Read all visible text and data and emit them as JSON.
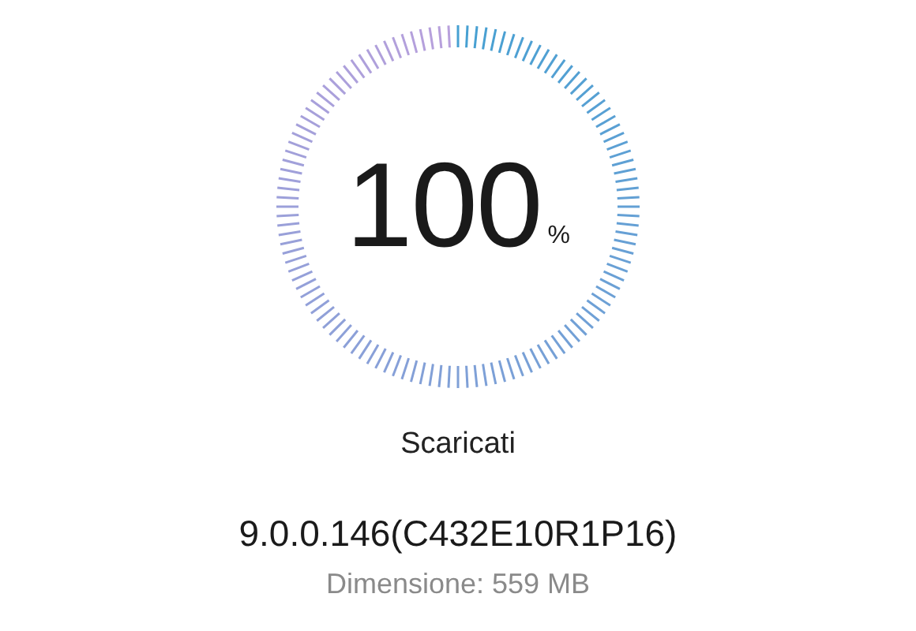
{
  "progress": {
    "value": "100",
    "unit": "%"
  },
  "status": "Scaricati",
  "version": "9.0.0.146(C432E10R1P16)",
  "size": "Dimensione: 559 MB"
}
